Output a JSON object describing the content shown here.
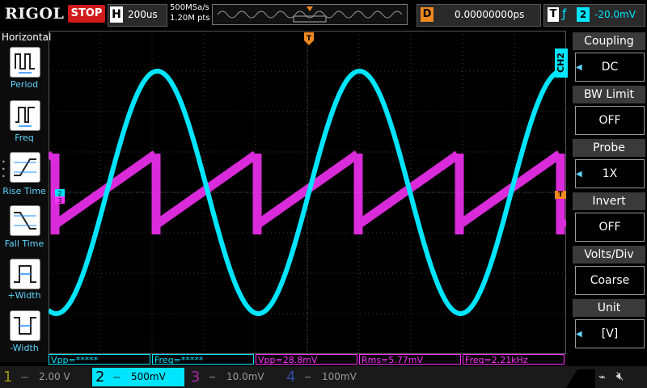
{
  "header": {
    "logo": "RIGOL",
    "run_state": "STOP",
    "timebase_label": "H",
    "timebase_value": "200us",
    "sample_rate": "500MSa/s",
    "memory_points": "1.20M pts",
    "delay_label": "D",
    "delay_value": "0.00000000ps",
    "trigger_label": "T",
    "trigger_source": "2",
    "trigger_level": "-20.0mV"
  },
  "left_menu": {
    "title": "Horizontal",
    "items": [
      {
        "label": "Period",
        "icon": "period-icon"
      },
      {
        "label": "Freq",
        "icon": "frequency-icon"
      },
      {
        "label": "Rise Time",
        "icon": "rise-time-icon"
      },
      {
        "label": "Fall Time",
        "icon": "fall-time-icon"
      },
      {
        "label": "+Width",
        "icon": "positive-width-icon"
      },
      {
        "label": "-Width",
        "icon": "negative-width-icon"
      }
    ]
  },
  "right_menu": {
    "channel_tag": "CH2",
    "items": [
      {
        "title": "Coupling",
        "value": "DC"
      },
      {
        "title": "BW Limit",
        "value": "OFF"
      },
      {
        "title": "Probe",
        "value": "1X"
      },
      {
        "title": "Invert",
        "value": "OFF"
      },
      {
        "title": "Volts/Div",
        "value": "Coarse"
      },
      {
        "title": "Unit",
        "value": "[V]"
      }
    ]
  },
  "measurements": [
    {
      "text": "Vpp=*****",
      "color": "#00e5ff"
    },
    {
      "text": "Freq=*****",
      "color": "#00e5ff"
    },
    {
      "text": "Vpp=28.8mV",
      "color": "#ff33ff"
    },
    {
      "text": "Rms=5.77mV",
      "color": "#ff33ff"
    },
    {
      "text": "Freq=2.21kHz",
      "color": "#ff33ff"
    }
  ],
  "channels": [
    {
      "num": "1",
      "scale": "2.00 V",
      "color": "#f5e400",
      "active": false
    },
    {
      "num": "2",
      "scale": "500mV",
      "color": "#00e5ff",
      "active": true
    },
    {
      "num": "3",
      "scale": "10.0mV",
      "color": "#ff33ff",
      "active": false
    },
    {
      "num": "4",
      "scale": "100mV",
      "color": "#3d6bff",
      "active": false
    }
  ],
  "markers": {
    "ch2": "2",
    "ch3": "3",
    "trigger_pos": "T"
  },
  "colors": {
    "ch2": "#00e5ff",
    "ch3": "#ff33ff",
    "trigger": "#f08a1e",
    "stop": "#d11a1a"
  }
}
